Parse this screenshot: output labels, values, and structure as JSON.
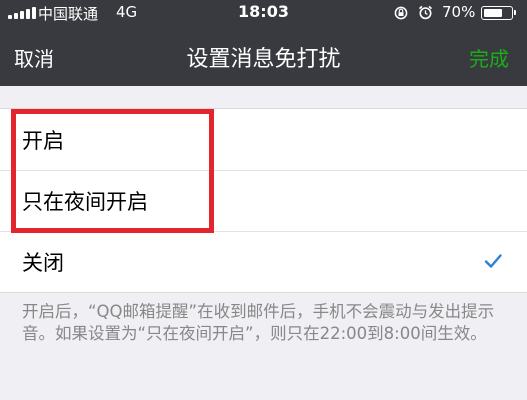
{
  "status_bar": {
    "carrier": "中国联通",
    "network": "4G",
    "time": "18:03",
    "battery_percent": "70%",
    "battery_level": 0.7,
    "icons": [
      "signal-bars-icon",
      "orientation-lock-icon",
      "alarm-icon",
      "battery-icon"
    ]
  },
  "nav": {
    "cancel_label": "取消",
    "title": "设置消息免打扰",
    "done_label": "完成"
  },
  "options": [
    {
      "label": "开启",
      "selected": false
    },
    {
      "label": "只在夜间开启",
      "selected": false
    },
    {
      "label": "关闭",
      "selected": true
    }
  ],
  "footnote": "开启后，“QQ邮箱提醒”在收到邮件后，手机不会震动与发出提示音。如果设置为“只在夜间开启”，则只在22:00到8:00间生效。",
  "colors": {
    "nav_background": "#393a3f",
    "done_green": "#1aad19",
    "checkmark_blue": "#2b82d9",
    "highlight_red": "#e3262e",
    "page_background": "#efeff4"
  }
}
